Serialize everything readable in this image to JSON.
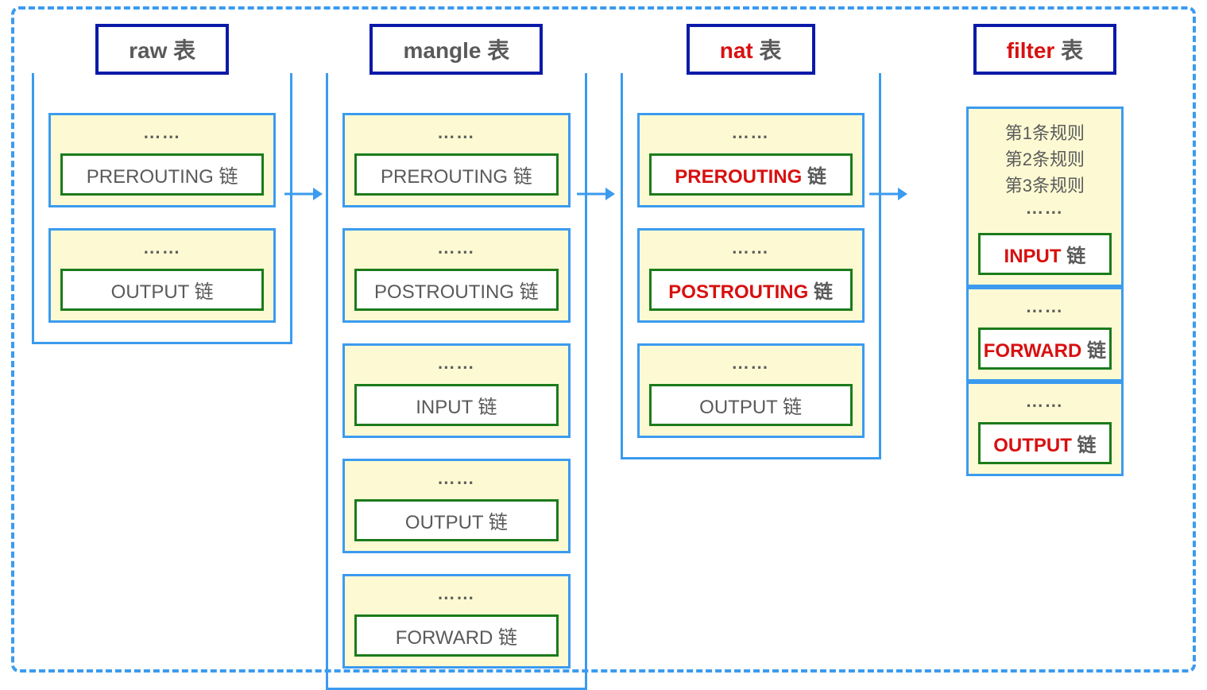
{
  "tables": {
    "raw": {
      "title": "raw 表",
      "chains": [
        {
          "pre": "⋯⋯",
          "label": "PREROUTING 链"
        },
        {
          "pre": "⋯⋯",
          "label": "OUTPUT 链"
        }
      ]
    },
    "mangle": {
      "title": "mangle 表",
      "chains": [
        {
          "pre": "⋯⋯",
          "label": "PREROUTING 链"
        },
        {
          "pre": "⋯⋯",
          "label": "POSTROUTING 链"
        },
        {
          "pre": "⋯⋯",
          "label": "INPUT 链"
        },
        {
          "pre": "⋯⋯",
          "label": "OUTPUT 链"
        },
        {
          "pre": "⋯⋯",
          "label": "FORWARD 链"
        }
      ]
    },
    "nat": {
      "title_prefix": "nat",
      "title_suffix": " 表",
      "chains": [
        {
          "pre": "⋯⋯",
          "em": "PREROUTING",
          "suffix": " 链",
          "red": true
        },
        {
          "pre": "⋯⋯",
          "em": "POSTROUTING",
          "suffix": " 链",
          "red": true
        },
        {
          "pre": "⋯⋯",
          "label": "OUTPUT 链",
          "red": false
        }
      ]
    },
    "filter": {
      "title_prefix": "filter",
      "title_suffix": " 表",
      "rules": {
        "line1": "第1条规则",
        "line2": "第2条规则",
        "line3": "第3条规则",
        "dots": "⋯⋯"
      },
      "chains": [
        {
          "em": "INPUT",
          "suffix": " 链"
        },
        {
          "pre": "⋯⋯",
          "em": "FORWARD",
          "suffix": " 链"
        },
        {
          "pre": "⋯⋯",
          "em": "OUTPUT",
          "suffix": " 链"
        }
      ]
    }
  }
}
